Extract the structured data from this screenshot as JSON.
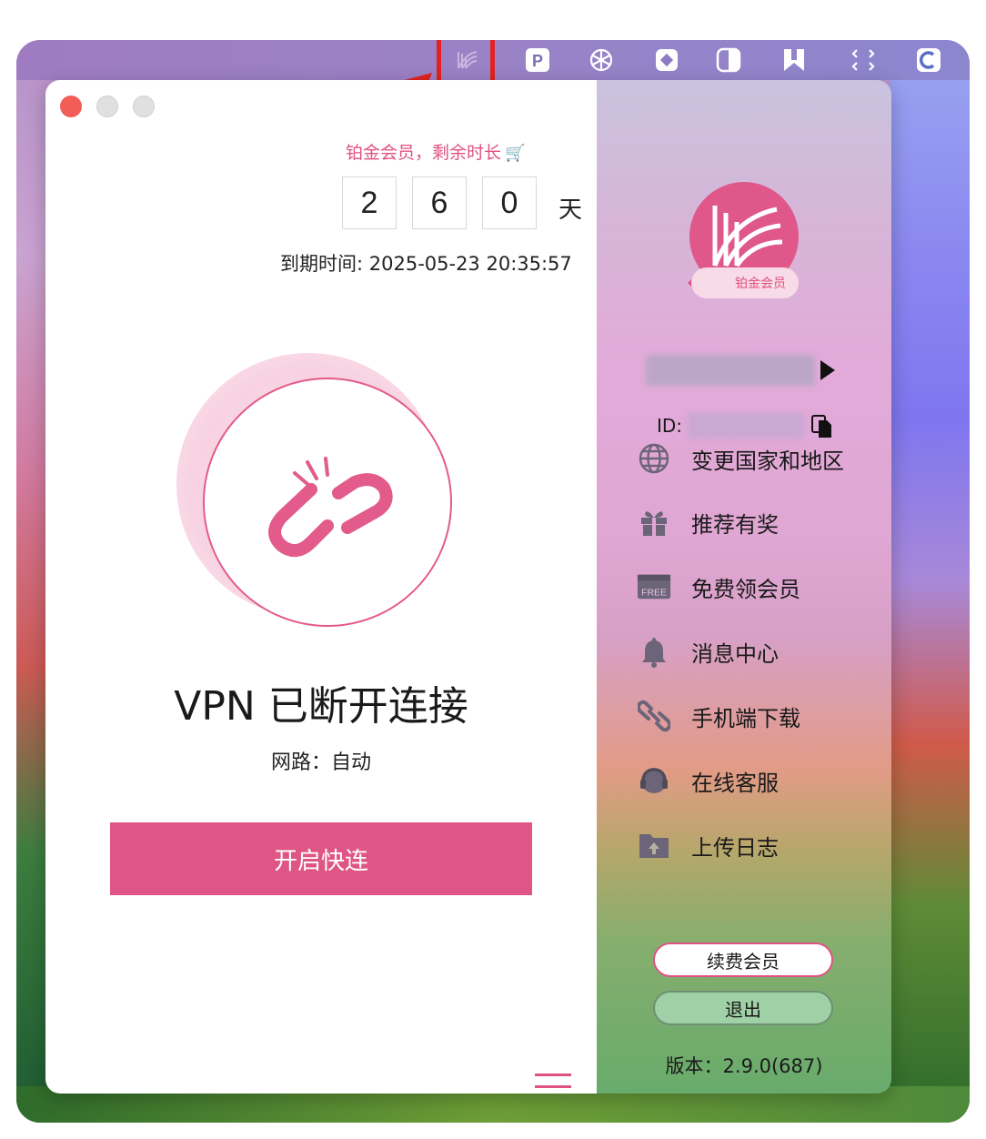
{
  "window": {
    "membership_notice": "铂金会员，剩余时长",
    "remaining_digits": [
      "2",
      "6",
      "0"
    ],
    "remaining_unit": "天",
    "expiry": "到期时间: 2025-05-23 20:35:57",
    "status": "VPN 已断开连接",
    "route": "网路：自动",
    "connect_button": "开启快连"
  },
  "profile": {
    "badge": "铂金会员",
    "id_label": "ID:"
  },
  "menu": [
    {
      "label": "变更国家和地区",
      "icon": "globe-icon"
    },
    {
      "label": "推荐有奖",
      "icon": "gift-icon"
    },
    {
      "label": "免费领会员",
      "icon": "free-ticket-icon"
    },
    {
      "label": "消息中心",
      "icon": "bell-icon"
    },
    {
      "label": "手机端下载",
      "icon": "link-icon"
    },
    {
      "label": "在线客服",
      "icon": "headset-icon"
    },
    {
      "label": "上传日志",
      "icon": "folder-upload-icon"
    }
  ],
  "free_icon_text": "FREE",
  "buttons": {
    "renew": "续费会员",
    "logout": "退出"
  },
  "version": "版本：2.9.0(687)",
  "colors": {
    "accent": "#df5686",
    "highlight_box": "#e2221f",
    "logout_bg": "#9fd0a6"
  },
  "menubar_icons": [
    "vpn-app-icon",
    "p-app-icon",
    "openai-icon",
    "puzzle-app-icon",
    "contrast-icon",
    "bookmark-app-icon",
    "expand-icon",
    "cleanup-app-icon"
  ]
}
